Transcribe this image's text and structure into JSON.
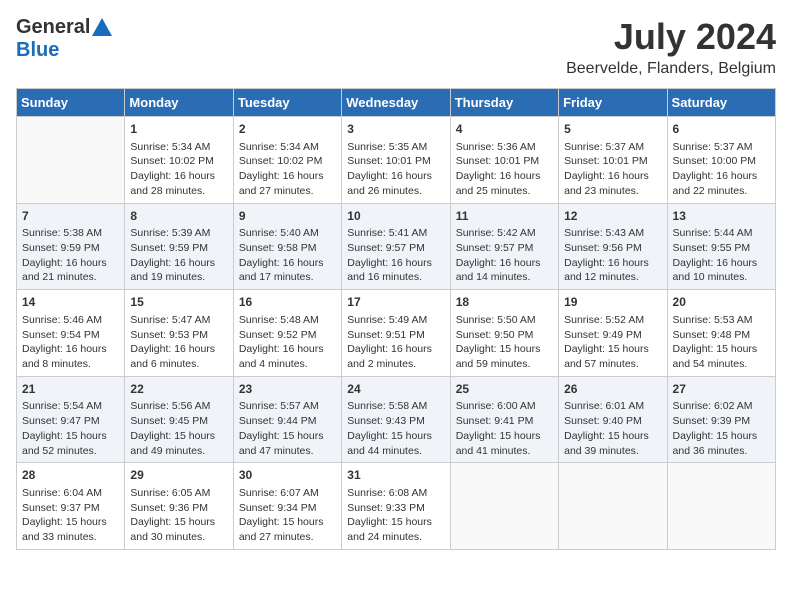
{
  "header": {
    "logo_general": "General",
    "logo_blue": "Blue",
    "title": "July 2024",
    "location": "Beervelde, Flanders, Belgium"
  },
  "days_of_week": [
    "Sunday",
    "Monday",
    "Tuesday",
    "Wednesday",
    "Thursday",
    "Friday",
    "Saturday"
  ],
  "weeks": [
    [
      {
        "date": "",
        "info": ""
      },
      {
        "date": "1",
        "info": "Sunrise: 5:34 AM\nSunset: 10:02 PM\nDaylight: 16 hours\nand 28 minutes."
      },
      {
        "date": "2",
        "info": "Sunrise: 5:34 AM\nSunset: 10:02 PM\nDaylight: 16 hours\nand 27 minutes."
      },
      {
        "date": "3",
        "info": "Sunrise: 5:35 AM\nSunset: 10:01 PM\nDaylight: 16 hours\nand 26 minutes."
      },
      {
        "date": "4",
        "info": "Sunrise: 5:36 AM\nSunset: 10:01 PM\nDaylight: 16 hours\nand 25 minutes."
      },
      {
        "date": "5",
        "info": "Sunrise: 5:37 AM\nSunset: 10:01 PM\nDaylight: 16 hours\nand 23 minutes."
      },
      {
        "date": "6",
        "info": "Sunrise: 5:37 AM\nSunset: 10:00 PM\nDaylight: 16 hours\nand 22 minutes."
      }
    ],
    [
      {
        "date": "7",
        "info": "Sunrise: 5:38 AM\nSunset: 9:59 PM\nDaylight: 16 hours\nand 21 minutes."
      },
      {
        "date": "8",
        "info": "Sunrise: 5:39 AM\nSunset: 9:59 PM\nDaylight: 16 hours\nand 19 minutes."
      },
      {
        "date": "9",
        "info": "Sunrise: 5:40 AM\nSunset: 9:58 PM\nDaylight: 16 hours\nand 17 minutes."
      },
      {
        "date": "10",
        "info": "Sunrise: 5:41 AM\nSunset: 9:57 PM\nDaylight: 16 hours\nand 16 minutes."
      },
      {
        "date": "11",
        "info": "Sunrise: 5:42 AM\nSunset: 9:57 PM\nDaylight: 16 hours\nand 14 minutes."
      },
      {
        "date": "12",
        "info": "Sunrise: 5:43 AM\nSunset: 9:56 PM\nDaylight: 16 hours\nand 12 minutes."
      },
      {
        "date": "13",
        "info": "Sunrise: 5:44 AM\nSunset: 9:55 PM\nDaylight: 16 hours\nand 10 minutes."
      }
    ],
    [
      {
        "date": "14",
        "info": "Sunrise: 5:46 AM\nSunset: 9:54 PM\nDaylight: 16 hours\nand 8 minutes."
      },
      {
        "date": "15",
        "info": "Sunrise: 5:47 AM\nSunset: 9:53 PM\nDaylight: 16 hours\nand 6 minutes."
      },
      {
        "date": "16",
        "info": "Sunrise: 5:48 AM\nSunset: 9:52 PM\nDaylight: 16 hours\nand 4 minutes."
      },
      {
        "date": "17",
        "info": "Sunrise: 5:49 AM\nSunset: 9:51 PM\nDaylight: 16 hours\nand 2 minutes."
      },
      {
        "date": "18",
        "info": "Sunrise: 5:50 AM\nSunset: 9:50 PM\nDaylight: 15 hours\nand 59 minutes."
      },
      {
        "date": "19",
        "info": "Sunrise: 5:52 AM\nSunset: 9:49 PM\nDaylight: 15 hours\nand 57 minutes."
      },
      {
        "date": "20",
        "info": "Sunrise: 5:53 AM\nSunset: 9:48 PM\nDaylight: 15 hours\nand 54 minutes."
      }
    ],
    [
      {
        "date": "21",
        "info": "Sunrise: 5:54 AM\nSunset: 9:47 PM\nDaylight: 15 hours\nand 52 minutes."
      },
      {
        "date": "22",
        "info": "Sunrise: 5:56 AM\nSunset: 9:45 PM\nDaylight: 15 hours\nand 49 minutes."
      },
      {
        "date": "23",
        "info": "Sunrise: 5:57 AM\nSunset: 9:44 PM\nDaylight: 15 hours\nand 47 minutes."
      },
      {
        "date": "24",
        "info": "Sunrise: 5:58 AM\nSunset: 9:43 PM\nDaylight: 15 hours\nand 44 minutes."
      },
      {
        "date": "25",
        "info": "Sunrise: 6:00 AM\nSunset: 9:41 PM\nDaylight: 15 hours\nand 41 minutes."
      },
      {
        "date": "26",
        "info": "Sunrise: 6:01 AM\nSunset: 9:40 PM\nDaylight: 15 hours\nand 39 minutes."
      },
      {
        "date": "27",
        "info": "Sunrise: 6:02 AM\nSunset: 9:39 PM\nDaylight: 15 hours\nand 36 minutes."
      }
    ],
    [
      {
        "date": "28",
        "info": "Sunrise: 6:04 AM\nSunset: 9:37 PM\nDaylight: 15 hours\nand 33 minutes."
      },
      {
        "date": "29",
        "info": "Sunrise: 6:05 AM\nSunset: 9:36 PM\nDaylight: 15 hours\nand 30 minutes."
      },
      {
        "date": "30",
        "info": "Sunrise: 6:07 AM\nSunset: 9:34 PM\nDaylight: 15 hours\nand 27 minutes."
      },
      {
        "date": "31",
        "info": "Sunrise: 6:08 AM\nSunset: 9:33 PM\nDaylight: 15 hours\nand 24 minutes."
      },
      {
        "date": "",
        "info": ""
      },
      {
        "date": "",
        "info": ""
      },
      {
        "date": "",
        "info": ""
      }
    ]
  ]
}
